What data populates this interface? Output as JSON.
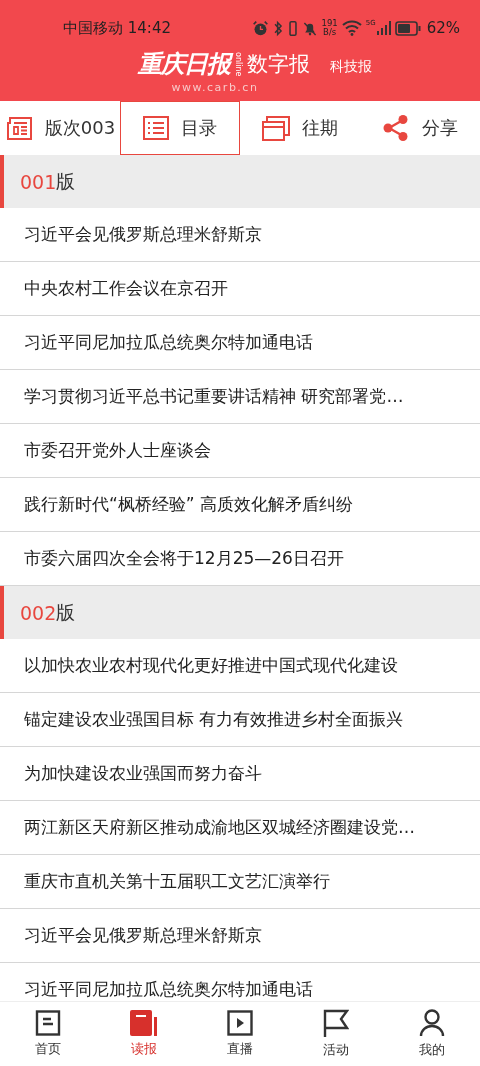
{
  "status_bar": {
    "carrier": "中国移动",
    "time": "14:42",
    "speed_value": "191",
    "speed_unit": "B/s",
    "network": "5G",
    "battery": "62%"
  },
  "header": {
    "logo": "重庆日报",
    "logo_tag": "online",
    "app_name": "数字报",
    "edition": "科技报",
    "url": "www.carb.cn"
  },
  "toolbar": [
    {
      "kind": "pages",
      "label": "版次003",
      "selected": false
    },
    {
      "kind": "contents",
      "label": "目录",
      "selected": true
    },
    {
      "kind": "archive",
      "label": "往期",
      "selected": false
    },
    {
      "kind": "share",
      "label": "分享",
      "selected": false
    }
  ],
  "sections": [
    {
      "number": "001",
      "suffix": "版",
      "articles": [
        "习近平会见俄罗斯总理米舒斯京",
        "中央农村工作会议在京召开",
        "习近平同尼加拉瓜总统奥尔特加通电话",
        "学习贯彻习近平总书记重要讲话精神 研究部署党…",
        "市委召开党外人士座谈会",
        "践行新时代“枫桥经验” 高质效化解矛盾纠纷",
        "市委六届四次全会将于12月25—26日召开"
      ]
    },
    {
      "number": "002",
      "suffix": "版",
      "articles": [
        "以加快农业农村现代化更好推进中国式现代化建设",
        "锚定建设农业强国目标 有力有效推进乡村全面振兴",
        "为加快建设农业强国而努力奋斗",
        "两江新区天府新区推动成渝地区双城经济圈建设党…",
        "重庆市直机关第十五届职工文艺汇演举行",
        "习近平会见俄罗斯总理米舒斯京",
        "习近平同尼加拉瓜总统奥尔特加通电话"
      ]
    }
  ],
  "bottom_nav": [
    {
      "kind": "home",
      "label": "首页",
      "selected": false
    },
    {
      "kind": "read",
      "label": "读报",
      "selected": true
    },
    {
      "kind": "live",
      "label": "直播",
      "selected": false
    },
    {
      "kind": "events",
      "label": "活动",
      "selected": false
    },
    {
      "kind": "me",
      "label": "我的",
      "selected": false
    }
  ]
}
